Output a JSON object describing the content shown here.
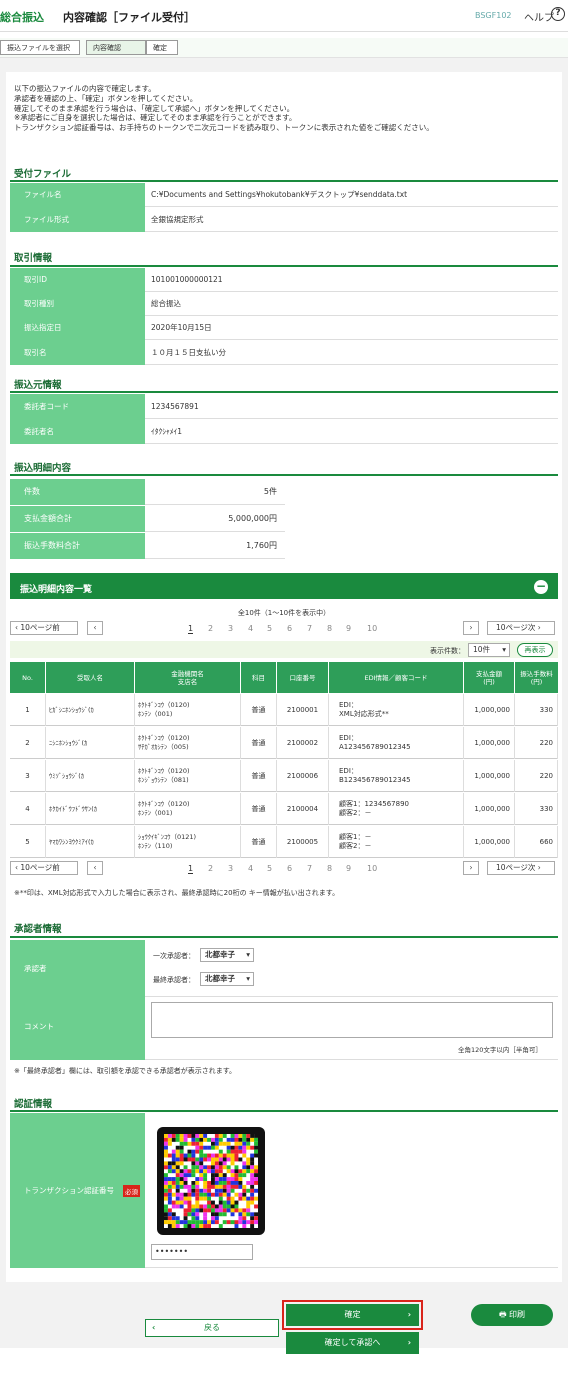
{
  "header": {
    "category": "総合振込",
    "title": "内容確認［ファイル受付］",
    "screen_id": "BSGF102",
    "help": "ヘルプ"
  },
  "steps": [
    "振込ファイルを選択",
    "内容確認",
    "確定"
  ],
  "intro": [
    "以下の振込ファイルの内容で確定します。",
    "承認者を確認の上、「確定」ボタンを押してください。",
    "確定してそのまま承認を行う場合は、「確定して承認へ」ボタンを押してください。",
    "※承認者にご自身を選択した場合は、確定してそのまま承認を行うことができます。",
    "トランザクション認証番号は、お手持ちのトークンで二次元コードを読み取り、トークンに表示された値をご確認ください。"
  ],
  "file_section": {
    "heading": "受付ファイル",
    "rows": [
      {
        "label": "ファイル名",
        "value": "C:¥Documents and Settings¥hokutobank¥デスクトップ¥senddata.txt"
      },
      {
        "label": "ファイル形式",
        "value": "全銀協規定形式"
      }
    ]
  },
  "trade_section": {
    "heading": "取引情報",
    "rows": [
      {
        "label": "取引ID",
        "value": "101001000000121"
      },
      {
        "label": "取引種別",
        "value": "総合振込"
      },
      {
        "label": "振込指定日",
        "value": "2020年10月15日"
      },
      {
        "label": "取引名",
        "value": "１０月１５日支払い分"
      }
    ]
  },
  "source_section": {
    "heading": "振込元情報",
    "rows": [
      {
        "label": "委託者コード",
        "value": "1234567891"
      },
      {
        "label": "委託者名",
        "value": "ｲﾀｸｼｬﾒｲ1"
      }
    ]
  },
  "summary_section": {
    "heading": "振込明細内容",
    "rows": [
      {
        "label": "件数",
        "value": "5件"
      },
      {
        "label": "支払金額合計",
        "value": "5,000,000円"
      },
      {
        "label": "振込手数料合計",
        "value": "1,760円"
      }
    ]
  },
  "list": {
    "heading": "振込明細内容一覧",
    "count_text": "全10件（1〜10件を表示中）",
    "prev10": "10ページ前",
    "next10": "10ページ次",
    "pages": [
      "1",
      "2",
      "3",
      "4",
      "5",
      "6",
      "7",
      "8",
      "9",
      "10"
    ],
    "display_label": "表示件数：",
    "display_value": "10件",
    "redisplay": "再表示",
    "columns": [
      "No.",
      "受取人名",
      "金融機関名\n支店名",
      "科目",
      "口座番号",
      "EDI情報／顧客コード",
      "支払金額\n(円)",
      "振込手数料\n(円)"
    ],
    "rows": [
      {
        "no": "1",
        "name": "ﾋｶﾞｼﾆﾎﾝｼｮｳｼﾞ(ｶ",
        "bank": "ﾎｸﾄｷﾞﾝｺｳ（0120)\nﾎﾝﾃﾝ（001)",
        "type": "普通",
        "account": "2100001",
        "edi": "EDI：\nXML対応形式**",
        "amount": "1,000,000",
        "fee": "330"
      },
      {
        "no": "2",
        "name": "ﾆｼﾆﾎﾝｼｮｳｼﾞ(ｶ",
        "bank": "ﾎｸﾄｷﾞﾝｺｳ（0120)\nｻﾁｶﾞｵｶｼﾃﾝ（005)",
        "type": "普通",
        "account": "2100002",
        "edi": "EDI：\nA123456789012345",
        "amount": "1,000,000",
        "fee": "220"
      },
      {
        "no": "3",
        "name": "ｳﾐｿﾞｼｮｳｼﾞ(ｶ",
        "bank": "ﾎｸﾄｷﾞﾝｺｳ（0120)\nﾎﾝｼﾞｮｳｼﾃﾝ（081)",
        "type": "普通",
        "account": "2100006",
        "edi": "EDI：\nB123456789012345",
        "amount": "1,000,000",
        "fee": "220"
      },
      {
        "no": "4",
        "name": "ﾎｸｶｲﾄﾞｳﾌﾄﾞｳｻﾝ(ｶ",
        "bank": "ﾎｸﾄｷﾞﾝｺｳ（0120)\nﾎﾝﾃﾝ（001)",
        "type": "普通",
        "account": "2100004",
        "edi": "顧客1：1234567890\n顧客2：－",
        "amount": "1,000,000",
        "fee": "330"
      },
      {
        "no": "5",
        "name": "ﾔﾏｶﾜｼﾝﾖｳｸﾐｱｲ(ｶ",
        "bank": "ｼｮｳｸｲｷﾞﾝｺｳ（0121)\nﾎﾝﾃﾝ（110)",
        "type": "普通",
        "account": "2100005",
        "edi": "顧客1：－\n顧客2：－",
        "amount": "1,000,000",
        "fee": "660"
      }
    ],
    "note": "※**印は、XML対応形式で入力した場合に表示され、最終承認時に20桁の キー情報が払い出されます。"
  },
  "approver": {
    "heading": "承認者情報",
    "label": "承認者",
    "first_label": "一次承認者：",
    "first_value": "北都幸子",
    "final_label": "最終承認者：",
    "final_value": "北都幸子",
    "comment_label": "コメント",
    "comment_hint": "全角120文字以内［半角可］",
    "note": "※「最終承認者」欄には、取引額を承認できる承認者が表示されます。"
  },
  "auth": {
    "heading": "認証情報",
    "label": "トランザクション認証番号",
    "required": "必須",
    "input_value": "•••••••"
  },
  "buttons": {
    "confirm": "確定",
    "print": "印刷",
    "back": "戻る",
    "confirm_approve": "確定して承認へ"
  },
  "colors": {
    "brand": "#1a8a3e",
    "label_bg": "#6ccf8f",
    "highlight": "#d9241b"
  }
}
